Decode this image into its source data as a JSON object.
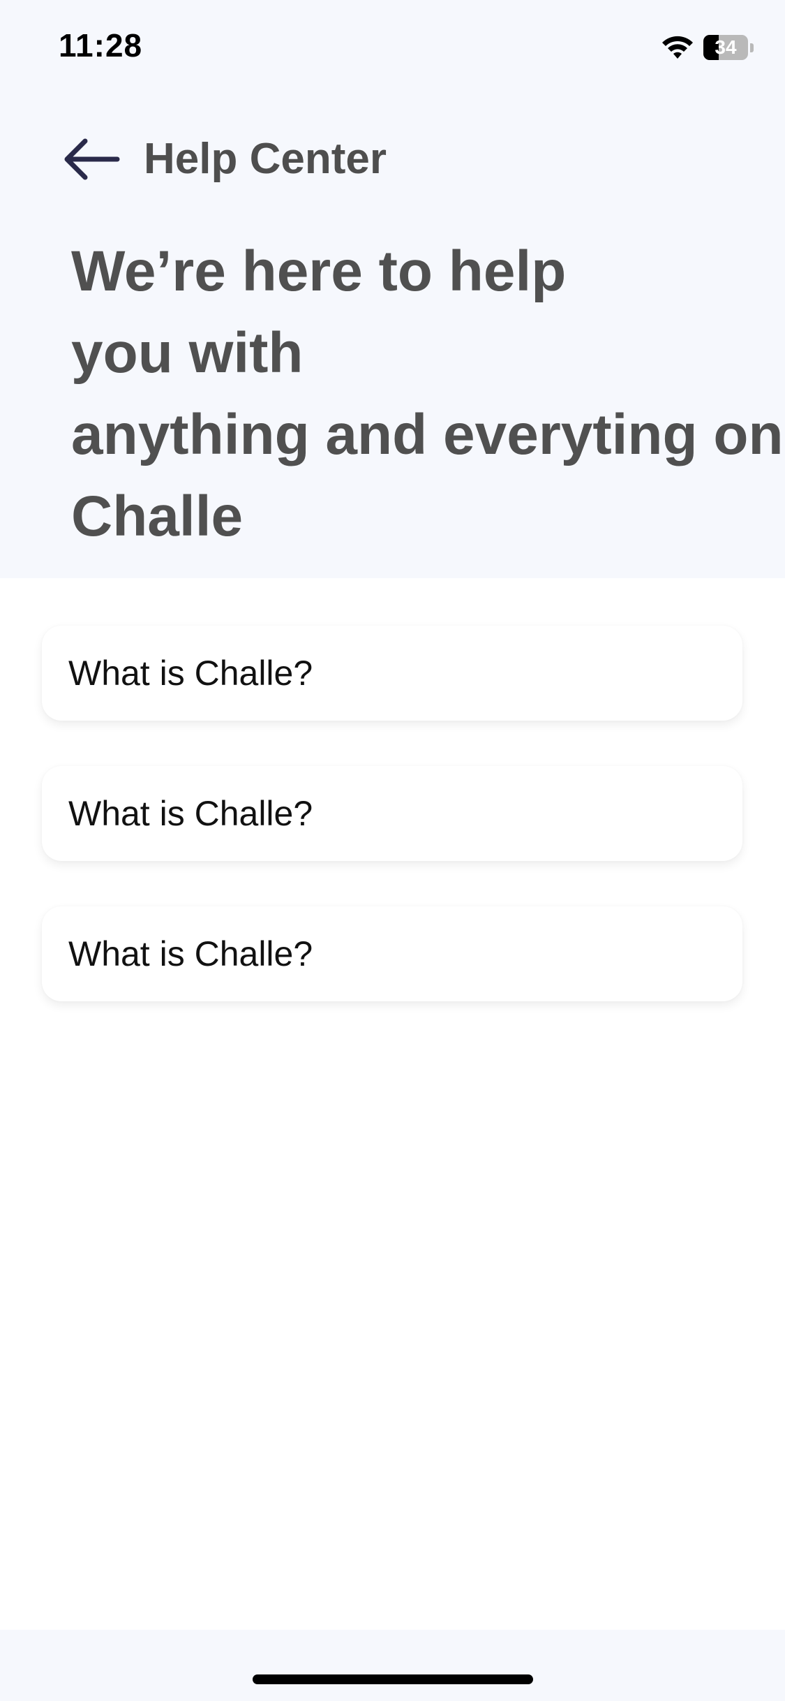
{
  "status_bar": {
    "time": "11:28",
    "battery_level": "34",
    "battery_fraction": 0.34,
    "icons": [
      "wifi-icon",
      "battery-icon"
    ]
  },
  "header": {
    "back_icon": "arrow-left-icon",
    "title": "Help Center",
    "headline_lines": [
      "We’re here to help",
      "you with",
      "anything and everyting on",
      "Challe"
    ]
  },
  "faq": {
    "items": [
      {
        "question": "What is Challe?"
      },
      {
        "question": "What is Challe?"
      },
      {
        "question": "What is Challe?"
      }
    ]
  },
  "colors": {
    "header_background": "#f6f8fd",
    "heading_text": "#505050",
    "back_arrow": "#2a2a4a",
    "card_background": "#ffffff"
  }
}
